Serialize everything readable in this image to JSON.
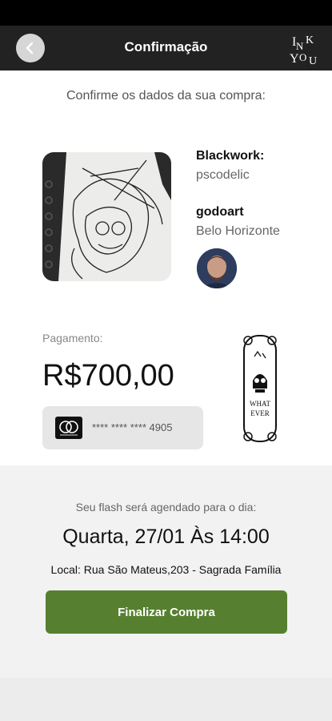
{
  "header": {
    "title": "Confirmação",
    "back_icon": "chevron-left-icon",
    "logo_text": "INK YOU"
  },
  "subtitle": "Confirme os dados da sua compra:",
  "product": {
    "style": "Blackwork:",
    "style_name": "pscodelic",
    "artist": "godoart",
    "city": "Belo Horizonte"
  },
  "payment": {
    "label": "Pagamento:",
    "amount": "R$700,00",
    "card_mask": "**** **** **** 4905",
    "card_icon": "mastercard-icon"
  },
  "schedule": {
    "label": "Seu flash será agendado para o dia:",
    "date": "Quarta, 27/01 Às 14:00",
    "location": "Local: Rua São Mateus,203 - Sagrada Família"
  },
  "action": {
    "finish_label": "Finalizar Compra"
  },
  "colors": {
    "appbar": "#222222",
    "accent_button": "#56802f",
    "panel": "#f2f2f2"
  }
}
